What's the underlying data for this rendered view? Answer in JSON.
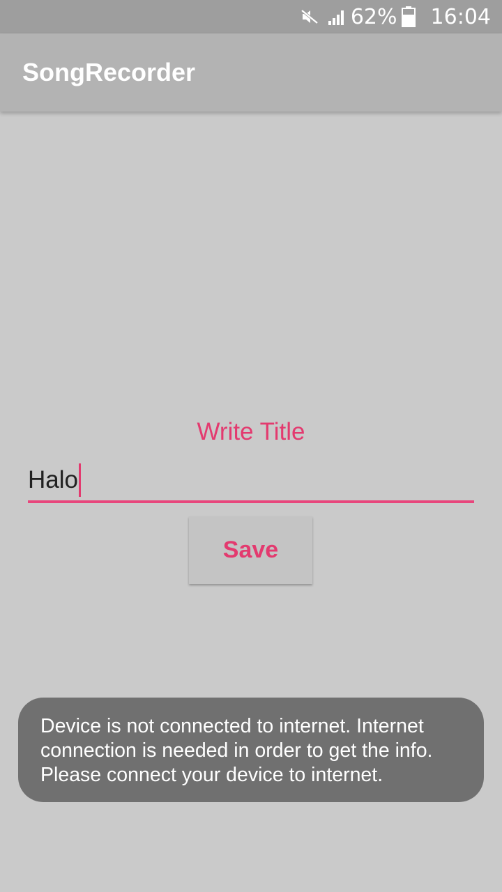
{
  "status_bar": {
    "battery_percent_label": "62%",
    "time": "16:04",
    "icons": [
      "mute-icon",
      "signal-icon",
      "battery-icon"
    ]
  },
  "app_bar": {
    "title": "SongRecorder"
  },
  "form": {
    "heading": "Write Title",
    "title_input_value": "Halo",
    "save_label": "Save"
  },
  "toast": {
    "message": "Device is not connected to internet. Internet connection is needed in order to get the info. Please connect your device to internet."
  },
  "colors": {
    "accent": "#e33a6f",
    "background": "#cacaca",
    "app_bar": "#b3b3b3",
    "status_bar": "#9e9e9e",
    "toast_bg": "#707070"
  }
}
